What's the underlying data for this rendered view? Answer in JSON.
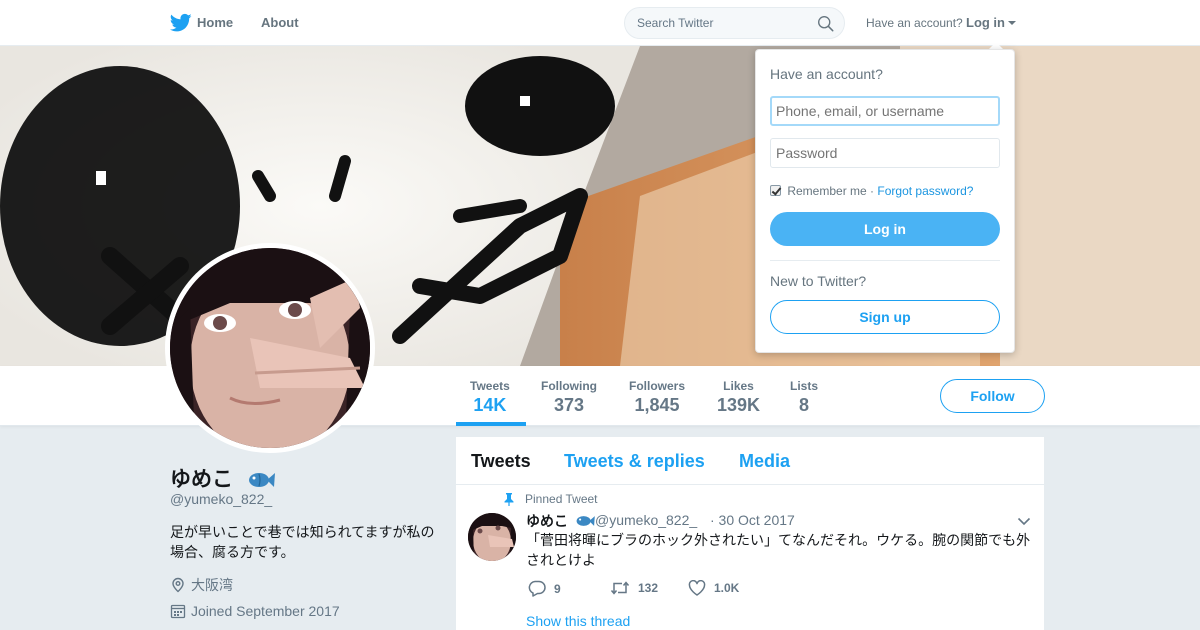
{
  "nav": {
    "home": "Home",
    "about": "About",
    "search_placeholder": "Search Twitter",
    "have_account": "Have an account?",
    "login": "Log in"
  },
  "profile": {
    "name": "ゆめこ",
    "handle": "@yumeko_822_",
    "bio": "足が早いことで巷では知られてますが私の場合、腐る方です。",
    "location": "大阪湾",
    "joined": "Joined September 2017",
    "follow_label": "Follow"
  },
  "stats": [
    {
      "label": "Tweets",
      "value": "14K"
    },
    {
      "label": "Following",
      "value": "373"
    },
    {
      "label": "Followers",
      "value": "1,845"
    },
    {
      "label": "Likes",
      "value": "139K"
    },
    {
      "label": "Lists",
      "value": "8"
    }
  ],
  "timeline": {
    "tabs": [
      "Tweets",
      "Tweets & replies",
      "Media"
    ],
    "tweet": {
      "pinned_label": "Pinned Tweet",
      "name": "ゆめこ",
      "handle": "@yumeko_822_",
      "date": "· 30 Oct 2017",
      "text": "「菅田将暉にブラのホック外されたい」てなんだそれ。ウケる。腕の関節でも外されとけよ",
      "replies": "9",
      "retweets": "132",
      "likes": "1.0K",
      "show_thread": "Show this thread"
    }
  },
  "login_dropdown": {
    "title": "Have an account?",
    "username_placeholder": "Phone, email, or username",
    "password_placeholder": "Password",
    "remember": "Remember me",
    "separator": "·",
    "forgot": "Forgot password?",
    "login_button": "Log in",
    "new_to": "New to Twitter?",
    "signup_button": "Sign up"
  },
  "colors": {
    "accent": "#1da1f2",
    "login_button": "#4ab3f4",
    "background": "#e6ecf0"
  }
}
